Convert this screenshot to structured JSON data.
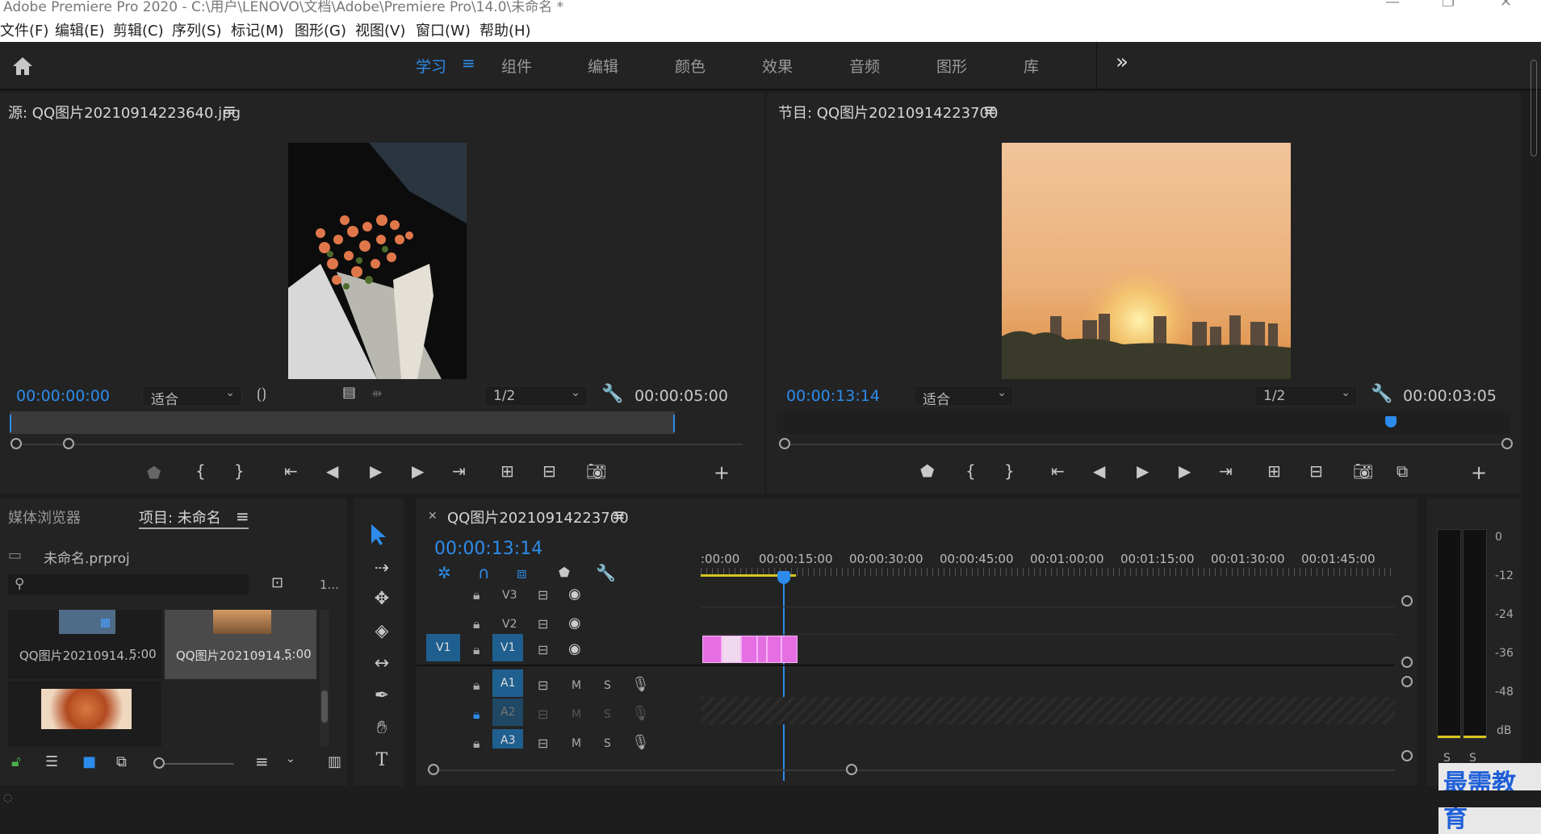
{
  "app": {
    "title": "Adobe Premiere Pro 2020 - C:\\用户\\LENOVO\\文档\\Adobe\\Premiere Pro\\14.0\\未命名 *"
  },
  "menu": [
    "文件(F)",
    "编辑(E)",
    "剪辑(C)",
    "序列(S)",
    "标记(M)",
    "图形(G)",
    "视图(V)",
    "窗口(W)",
    "帮助(H)"
  ],
  "workspaces": {
    "items": [
      "学习",
      "组件",
      "编辑",
      "颜色",
      "效果",
      "音频",
      "图形",
      "库"
    ],
    "active": "学习",
    "more_label": "»"
  },
  "source_monitor": {
    "title": "源: QQ图片20210914223640.jpg",
    "timecode": "00:00:00:00",
    "fit": "适合",
    "resolution": "1/2",
    "duration": "00:00:05:00"
  },
  "program_monitor": {
    "title": "节目: QQ图片20210914223700",
    "timecode": "00:00:13:14",
    "fit": "适合",
    "resolution": "1/2",
    "duration": "00:00:03:05"
  },
  "project_panel": {
    "tab_media": "媒体浏览器",
    "tab_project": "项目: 未命名",
    "file": "未命名.prproj",
    "search_placeholder": "",
    "count": "1...",
    "items": [
      {
        "name": "QQ图片20210914...",
        "duration": "5:00"
      },
      {
        "name": "QQ图片20210914...",
        "duration": "5:00"
      },
      {
        "name": "",
        "duration": ""
      }
    ]
  },
  "timeline": {
    "sequence": "QQ图片20210914223700",
    "timecode": "00:00:13:14",
    "ruler": [
      ":00:00",
      "00:00:15:00",
      "00:00:30:00",
      "00:00:45:00",
      "00:01:00:00",
      "00:01:15:00",
      "00:01:30:00",
      "00:01:45:00"
    ],
    "tracks": {
      "video": [
        "V3",
        "V2",
        "V1"
      ],
      "audio": [
        "A1",
        "A2",
        "A3"
      ],
      "source_patch": "V1",
      "m": "M",
      "s": "S"
    }
  },
  "audio_meter": {
    "scale": [
      "0",
      "-12",
      "-24",
      "-36",
      "-48",
      "dB"
    ],
    "solo": [
      "S",
      "S"
    ]
  },
  "watermark": "最需教育",
  "colors": {
    "accent": "#2d8ceb",
    "clip": "#e56ee3",
    "panel": "#232323",
    "bg": "#1d1d1d"
  }
}
